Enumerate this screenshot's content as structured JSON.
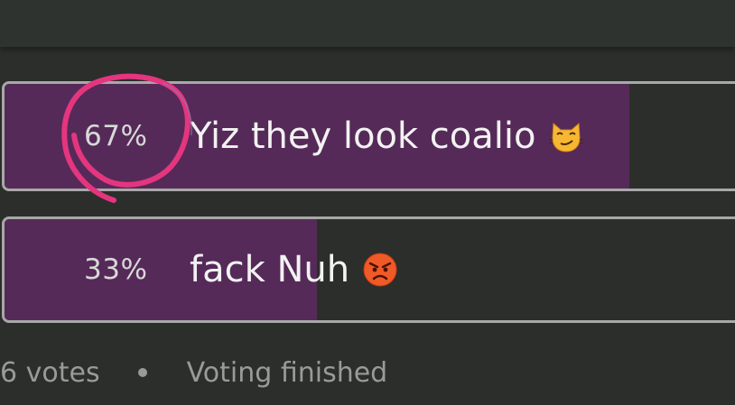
{
  "poll": {
    "options": [
      {
        "percent_label": "67%",
        "fraction": 0.67,
        "text": "Yiz they look coalio",
        "emoji_icon": "smirking-cat-icon"
      },
      {
        "percent_label": "33%",
        "fraction": 0.33,
        "text": "fack Nuh",
        "emoji_icon": "angry-face-icon"
      }
    ],
    "footer": {
      "votes": "6 votes",
      "status": "Voting finished"
    }
  },
  "colors": {
    "background": "#2b2e2b",
    "fill": "#552a58",
    "border": "#a8a8a8",
    "annotation": "#e5357f"
  }
}
